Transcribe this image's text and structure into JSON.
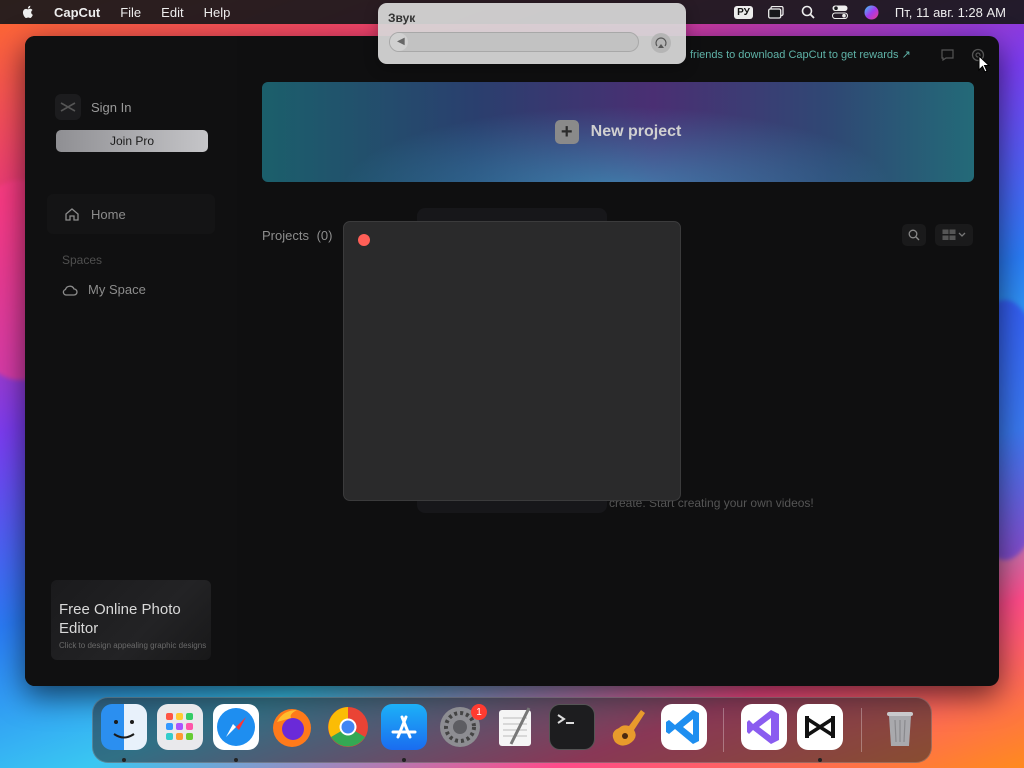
{
  "menubar": {
    "app": "CapCut",
    "items": [
      "File",
      "Edit",
      "Help"
    ],
    "input_source": "РУ",
    "clock": "Пт, 11 авг.  1:28 AM"
  },
  "sound_popup": {
    "title": "Звук",
    "volume_level": 0.02
  },
  "capcut": {
    "sign_in": "Sign In",
    "join_pro": "Join Pro",
    "nav_home": "Home",
    "spaces_title": "Spaces",
    "my_space": "My Space",
    "promo_title": "Free Online Photo Editor",
    "promo_subtitle": "Click to design appealing graphic designs",
    "invite_text": "friends to download CapCut to get rewards ↗",
    "new_project": "New project",
    "projects_label": "Projects",
    "projects_count": "(0)",
    "empty_text": "create. Start creating your own videos!"
  },
  "dock": {
    "apps": [
      "Finder",
      "Launchpad",
      "Safari",
      "Firefox",
      "Google Chrome",
      "App Store",
      "System Settings",
      "TextEdit",
      "Terminal",
      "GarageBand",
      "Visual Studio Code",
      "Visual Studio",
      "CapCut",
      "Trash"
    ],
    "settings_badge": "1"
  },
  "colors": {
    "accent_close": "#ff5f57",
    "badge": "#ff3b30",
    "window_bg": "#0f0f10"
  }
}
